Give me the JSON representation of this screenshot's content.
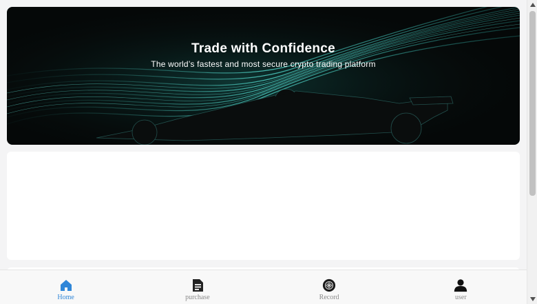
{
  "banner": {
    "title": "Trade with Confidence",
    "subtitle": "The world’s fastest and most secure crypto trading platform"
  },
  "tabbar": {
    "items": [
      {
        "label": "Home",
        "icon": "home-icon",
        "active": true
      },
      {
        "label": "purchase",
        "icon": "document-icon",
        "active": false
      },
      {
        "label": "Record",
        "icon": "record-icon",
        "active": false
      },
      {
        "label": "user",
        "icon": "user-icon",
        "active": false
      }
    ]
  },
  "colors": {
    "accent": "#2f86d8",
    "inactive_label": "#8a8a8a",
    "banner_bg": "#050808",
    "streak": "#3fb8ad"
  }
}
